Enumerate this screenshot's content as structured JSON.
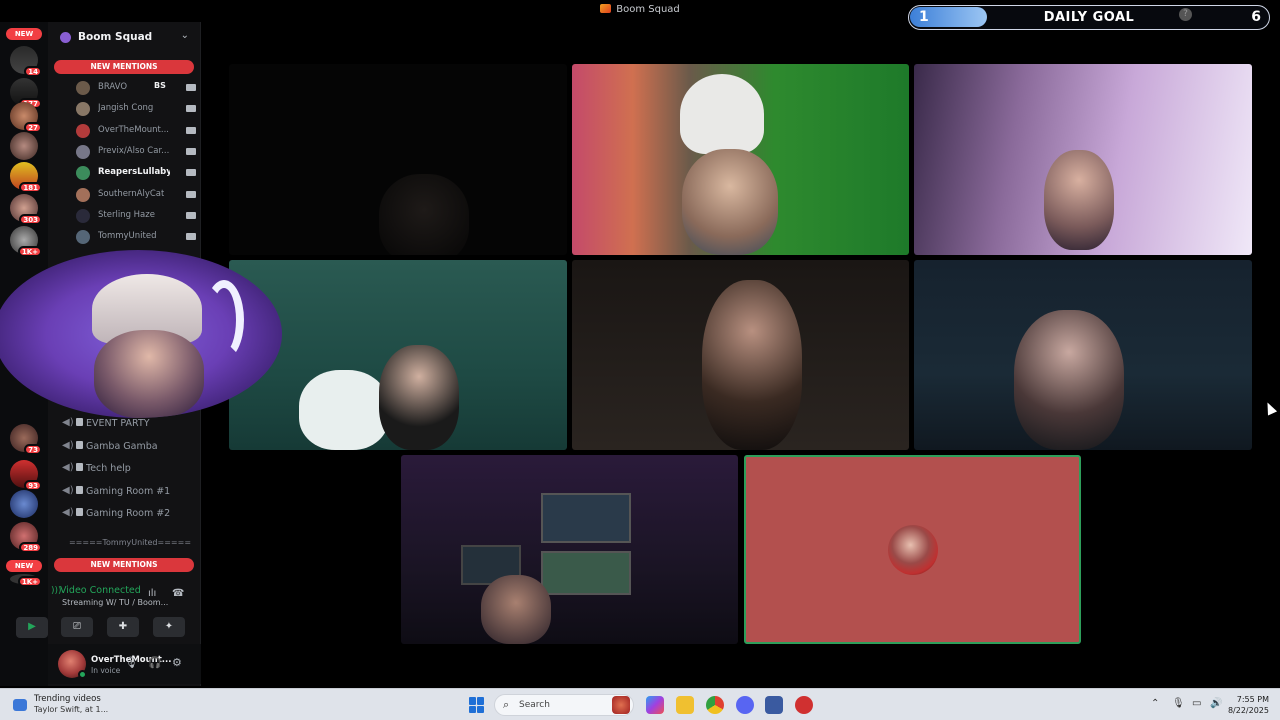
{
  "window": {
    "title": "Boom Squad"
  },
  "daily_goal": {
    "label": "DAILY GOAL",
    "current": "1",
    "max": "6",
    "progress_fraction": 0.167,
    "accent": "#3c7fd8"
  },
  "server_rail": {
    "new_label": "NEW",
    "badges": [
      "14",
      "177",
      "27",
      "181",
      "303",
      "1K+",
      "73",
      "93",
      "289"
    ],
    "bottom_new_label": "NEW",
    "bottom_badge": "1K+"
  },
  "sidebar": {
    "server_name": "Boom Squad",
    "new_mentions_top": "NEW MENTIONS",
    "new_mentions_bottom": "NEW MENTIONS",
    "voice_users": [
      {
        "name": "BRAVO",
        "tag": "BS",
        "bold": false,
        "color": "#6b5a4a"
      },
      {
        "name": "Jangish Cong",
        "bold": false,
        "color": "#887766"
      },
      {
        "name": "OverTheMount...",
        "bold": false,
        "color": "#b23b3b"
      },
      {
        "name": "Previx/Also Car...",
        "bold": false,
        "color": "#777788"
      },
      {
        "name": "ReapersLullaby",
        "bold": true,
        "color": "#3c8c5c"
      },
      {
        "name": "SouthernAlyCat",
        "bold": false,
        "color": "#a3705a"
      },
      {
        "name": "Sterling Haze",
        "bold": false,
        "color": "#2a2a3a"
      },
      {
        "name": "TommyUnited",
        "bold": false,
        "color": "#556677"
      }
    ],
    "voice_channels": [
      {
        "name": "EVENT PARTY",
        "icon": "flag-icon"
      },
      {
        "name": "Gamba Gamba",
        "icon": "slot-icon"
      },
      {
        "name": "Tech help",
        "icon": "keyboard-icon"
      },
      {
        "name": "Gaming Room #1",
        "icon": "speaker-icon"
      },
      {
        "name": "Gaming Room #2",
        "icon": "speaker-icon"
      }
    ],
    "category_divider": "=====TommyUnited====="
  },
  "voice_panel": {
    "status": "Video Connected",
    "activity": "Streaming W/ TU / Boom..."
  },
  "user_panel": {
    "username": "OverTheMount...",
    "status": "In voice"
  },
  "taskbar": {
    "widget_title": "Trending videos",
    "widget_sub": "Taylor Swift, at 1...",
    "search_placeholder": "Search",
    "time": "7:55 PM",
    "date": "8/22/2025"
  },
  "colors": {
    "speaking_border": "#2e9e5a",
    "mention_red": "#da373c",
    "connected_green": "#23a55a",
    "placeholder_tile": "#b3504e"
  }
}
